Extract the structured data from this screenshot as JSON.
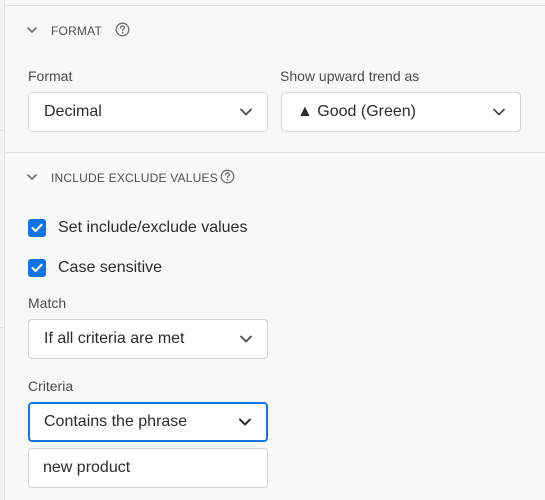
{
  "format_section": {
    "title": "FORMAT",
    "format_label": "Format",
    "format_value": "Decimal",
    "trend_label": "Show upward trend as",
    "trend_value": "▲ Good (Green)"
  },
  "include_section": {
    "title": "INCLUDE EXCLUDE VALUES",
    "checkbox_set_label": "Set include/exclude values",
    "checkbox_set_checked": true,
    "checkbox_case_label": "Case sensitive",
    "checkbox_case_checked": true,
    "match_label": "Match",
    "match_value": "If all criteria are met",
    "criteria_label": "Criteria",
    "criteria_value": "Contains the phrase",
    "criteria_text": "new product"
  },
  "colors": {
    "accent": "#1473e6",
    "border": "#d5d5d5",
    "background": "#f8f8f8"
  },
  "icons": [
    "chevron-down-icon",
    "help-circle-icon",
    "checkmark-icon",
    "caret-down-icon"
  ]
}
